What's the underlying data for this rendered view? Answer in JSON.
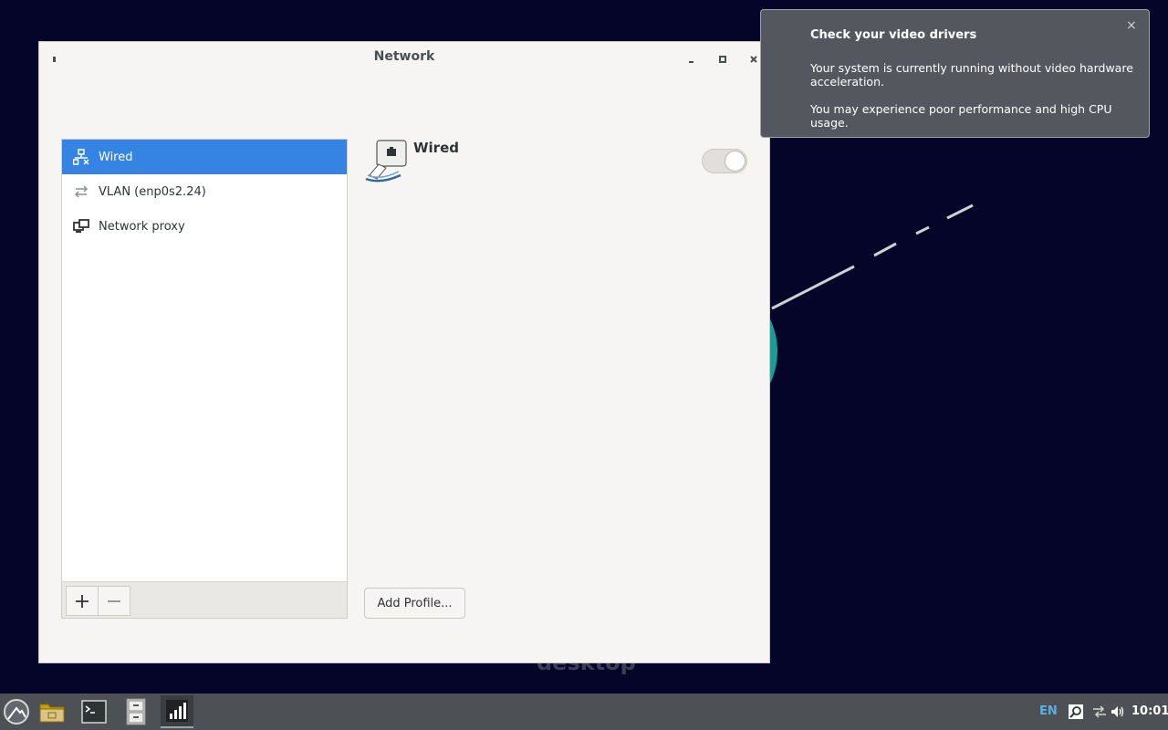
{
  "desktop": {
    "watermark_text": "desktop"
  },
  "window": {
    "title": "Network"
  },
  "sidebar": {
    "items": [
      {
        "label": "Wired",
        "icon": "wired-network-icon",
        "selected": true
      },
      {
        "label": "VLAN (enp0s2.24)",
        "icon": "vlan-arrows-icon",
        "selected": false
      },
      {
        "label": "Network proxy",
        "icon": "network-proxy-icon",
        "selected": false
      }
    ],
    "add_icon": "plus-icon",
    "remove_icon": "minus-icon"
  },
  "detail": {
    "title": "Wired",
    "icon": "ethernet-cable-icon",
    "toggle_state": "off",
    "add_profile_label": "Add Profile..."
  },
  "notification": {
    "title": "Check your video drivers",
    "body_line1": "Your system is currently running without video hardware acceleration.",
    "body_line2": "You may experience poor performance and high CPU usage.",
    "close_glyph": "×"
  },
  "taskbar": {
    "apps": [
      "menu-icon",
      "file-manager-icon",
      "terminal-icon",
      "file-cabinet-icon",
      "network-signal-icon"
    ],
    "language": "EN",
    "clock": "10:01"
  },
  "colors": {
    "desktop_bg": "#05052a",
    "accent": "#3584e4",
    "teal": "#1c9c95",
    "taskbar_bg": "#4d5156",
    "notification_bg": "#54575e"
  }
}
